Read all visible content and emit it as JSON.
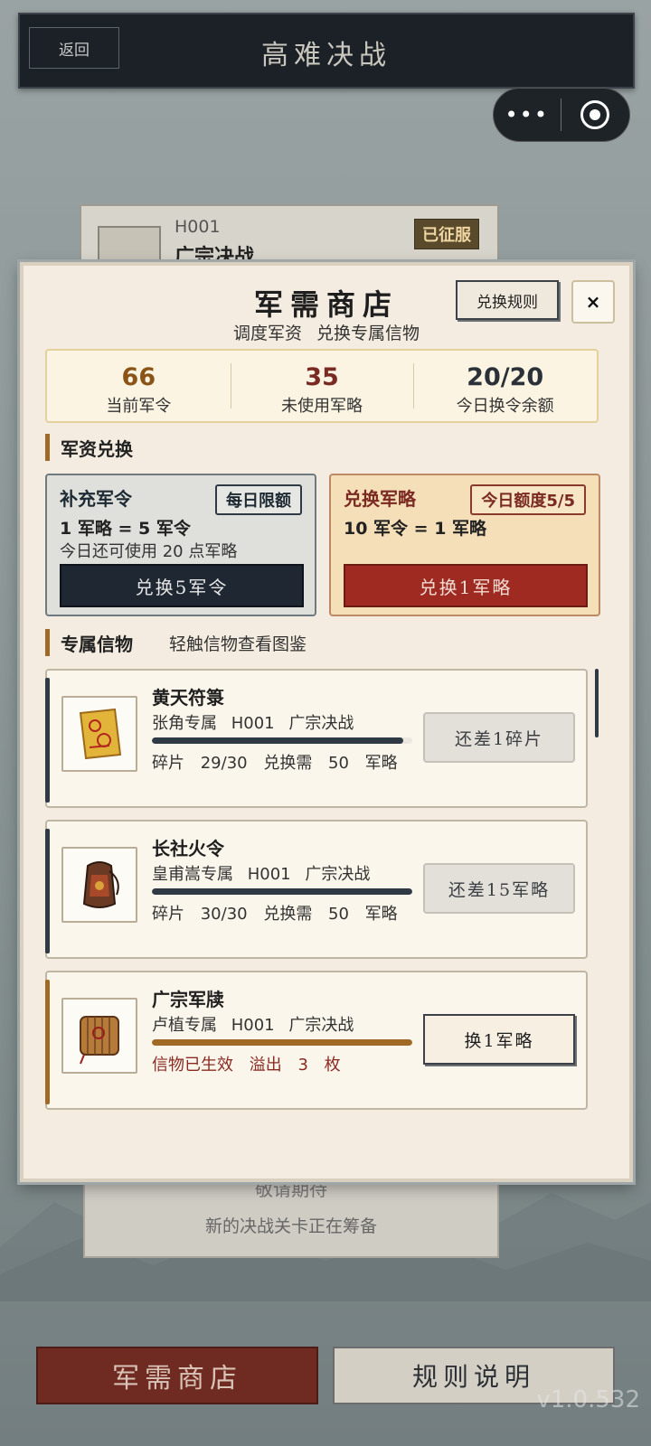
{
  "topbar": {
    "back_label": "返回",
    "title": "高难决战"
  },
  "capsule": {
    "menu_icon": "more-dots-icon",
    "close_icon": "target-icon"
  },
  "background_stage": {
    "code": "H001",
    "name": "广宗决战",
    "badge": "已征服"
  },
  "background_lower": {
    "title": "敬请期待",
    "note": "新的决战关卡正在筹备"
  },
  "bottom_bar": {
    "shop_label": "军需商店",
    "rules_label": "规则说明"
  },
  "version": "v1.0.532",
  "modal": {
    "title": "军需商店",
    "subtitle": "调度军资 兑换专属信物",
    "rules_button": "兑换规则",
    "close_label": "×",
    "stats": [
      {
        "value": "66",
        "label": "当前军令",
        "color": "#8a5317"
      },
      {
        "value": "35",
        "label": "未使用军略",
        "color": "#7a2a22"
      },
      {
        "value": "20/20",
        "label": "今日换令余额",
        "color": "#2b3138"
      }
    ],
    "exchange_section": {
      "title": "军资兑换"
    },
    "exchange": [
      {
        "title": "补充军令",
        "badge": "每日限额",
        "rate": "1 军略 = 5 军令",
        "note": "今日还可使用 20 点军略",
        "button": "兑换5军令"
      },
      {
        "title": "兑换军略",
        "badge": "今日额度5/5",
        "rate": "10 军令 = 1 军略",
        "note": "",
        "button": "兑换1军略"
      }
    ],
    "items_section": {
      "title": "专属信物",
      "hint": "轻触信物查看图鉴"
    },
    "items": [
      {
        "name": "黄天符箓",
        "owner": "张角专属 H001 广宗决战",
        "progress": 0.9667,
        "status": "碎片 29/30 兑换需 50 军略",
        "button": "还差1碎片",
        "icon": "talisman-scroll-icon",
        "accent": "#2f3a45"
      },
      {
        "name": "长社火令",
        "owner": "皇甫嵩专属 H001 广宗决战",
        "progress": 1.0,
        "status": "碎片 30/30 兑换需 50 军略",
        "button": "还差15军略",
        "icon": "fire-token-pouch-icon",
        "accent": "#2f3a45"
      },
      {
        "name": "广宗军牍",
        "owner": "卢植专属 H001 广宗决战",
        "progress": 1.0,
        "status": "信物已生效 溢出 3 枚",
        "button": "换1军略",
        "icon": "bamboo-scroll-icon",
        "accent": "#a06a26"
      }
    ]
  }
}
